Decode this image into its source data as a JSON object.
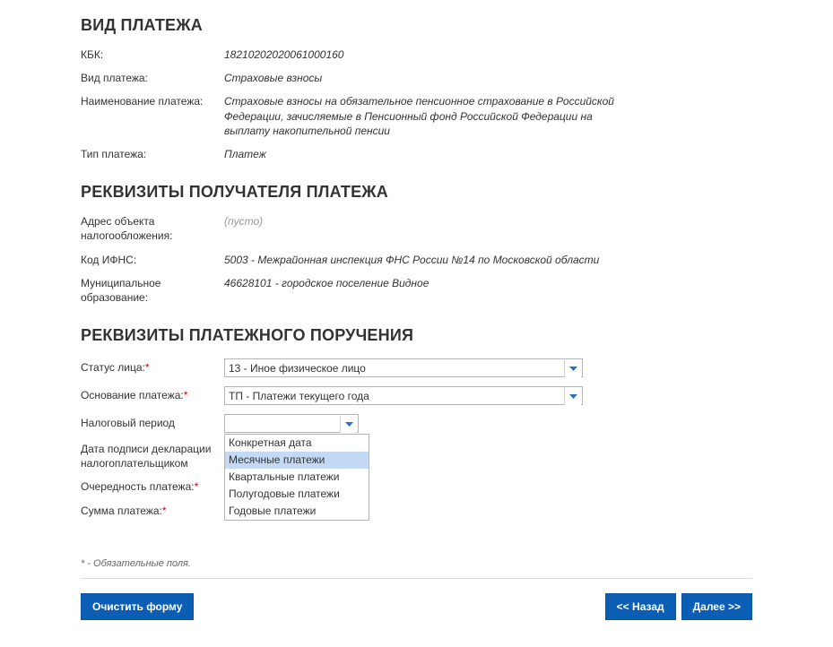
{
  "section1_title": "ВИД ПЛАТЕЖА",
  "kbk_label": "КБК:",
  "kbk_value": "18210202020061000160",
  "payment_kind_label": "Вид платежа:",
  "payment_kind_value": "Страховые взносы",
  "payment_name_label": "Наименование платежа:",
  "payment_name_value": "Страховые взносы на обязательное пенсионное страхование в Российской Федерации, зачисляемые в Пенсионный фонд Российской Федерации на выплату накопительной пенсии",
  "payment_type_label": "Тип платежа:",
  "payment_type_value": "Платеж",
  "section2_title": "РЕКВИЗИТЫ ПОЛУЧАТЕЛЯ ПЛАТЕЖА",
  "tax_addr_label": "Адрес объекта налогообложения:",
  "tax_addr_value": "(пусто)",
  "ifns_label": "Код ИФНС:",
  "ifns_value": "5003 - Межрайонная инспекция ФНС России №14 по Московской области",
  "muni_label": "Муниципальное образование:",
  "muni_value": "46628101 - городское поселение Видное",
  "section3_title": "РЕКВИЗИТЫ ПЛАТЕЖНОГО ПОРУЧЕНИЯ",
  "status_label": "Статус лица:",
  "status_value": "13 - Иное физическое лицо",
  "basis_label": "Основание платежа:",
  "basis_value": "ТП - Платежи текущего года",
  "period_label": "Налоговый период",
  "period_value": "",
  "sign_date_label": "Дата подписи декларации налогоплательщиком",
  "order_label": "Очередность платежа:",
  "amount_label": "Сумма платежа:",
  "period_options": [
    {
      "label": "Конкретная дата",
      "highlight": false
    },
    {
      "label": "Месячные платежи",
      "highlight": true
    },
    {
      "label": "Квартальные платежи",
      "highlight": false
    },
    {
      "label": "Полугодовые платежи",
      "highlight": false
    },
    {
      "label": "Годовые платежи",
      "highlight": false
    }
  ],
  "required_star": "*",
  "footnote_text": "* - Обязательные поля.",
  "btn_clear": "Очистить форму",
  "btn_back": "<< Назад",
  "btn_next": "Далее >>"
}
